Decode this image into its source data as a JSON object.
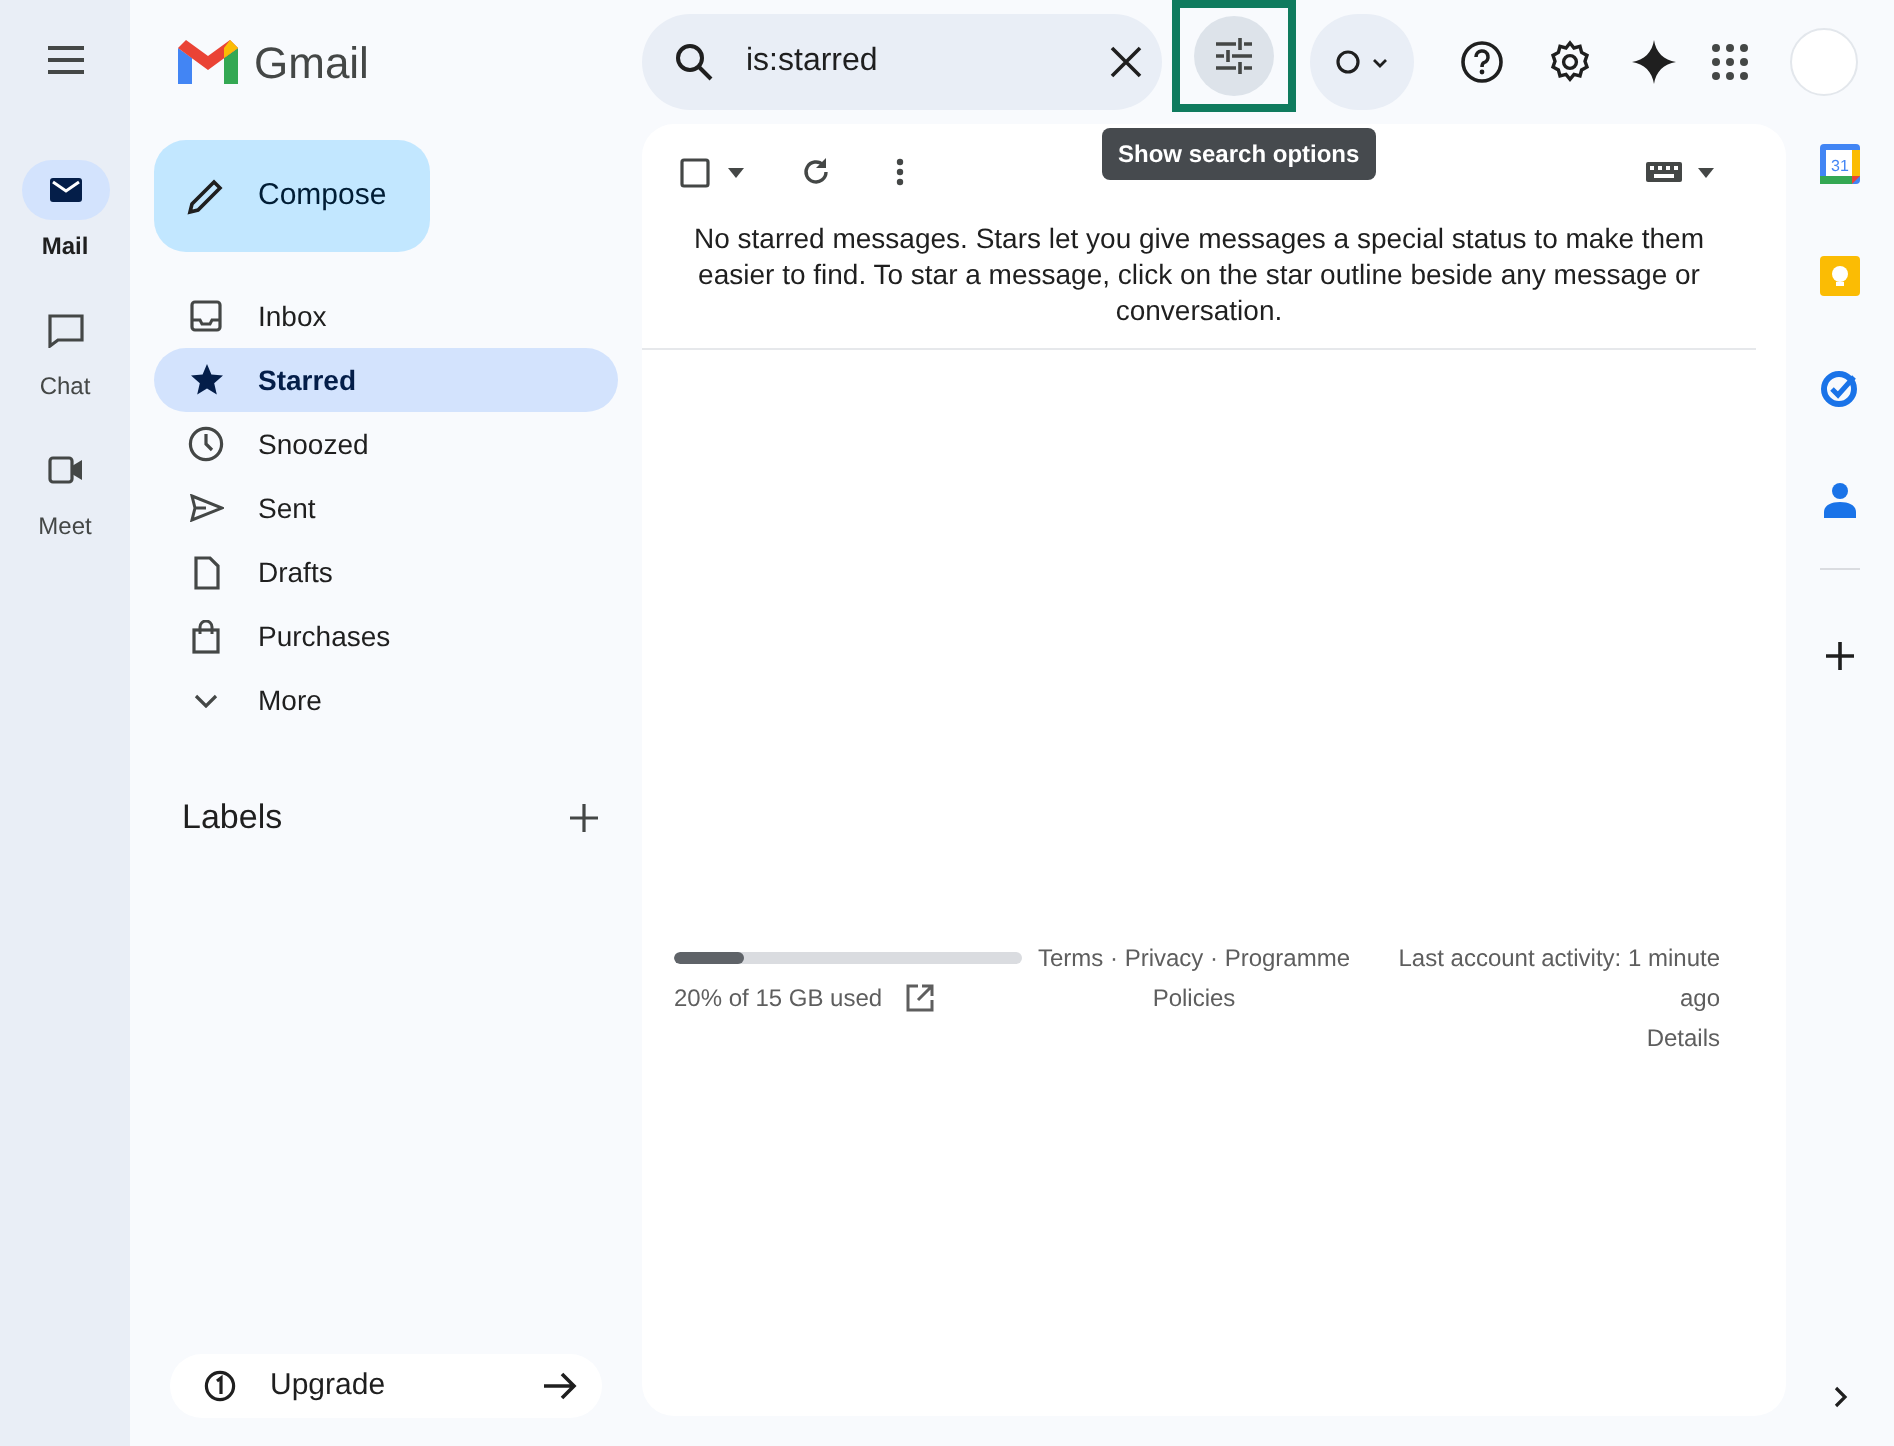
{
  "app_rail": [
    {
      "label": "Mail",
      "kind": "mail",
      "selected": true
    },
    {
      "label": "Chat",
      "kind": "chat",
      "selected": false
    },
    {
      "label": "Meet",
      "kind": "meet",
      "selected": false
    }
  ],
  "logo": {
    "text": "Gmail"
  },
  "compose": {
    "label": "Compose"
  },
  "nav": [
    {
      "label": "Inbox",
      "kind": "inbox",
      "selected": false
    },
    {
      "label": "Starred",
      "kind": "star",
      "selected": true
    },
    {
      "label": "Snoozed",
      "kind": "clock",
      "selected": false
    },
    {
      "label": "Sent",
      "kind": "send",
      "selected": false
    },
    {
      "label": "Drafts",
      "kind": "file",
      "selected": false
    },
    {
      "label": "Purchases",
      "kind": "bag",
      "selected": false
    },
    {
      "label": "More",
      "kind": "chevron",
      "selected": false
    }
  ],
  "labels": {
    "title": "Labels"
  },
  "upgrade": {
    "label": "Upgrade"
  },
  "search": {
    "value": "is:starred"
  },
  "search_options": {
    "tooltip": "Show search options",
    "highlighted": true
  },
  "select_all": {
    "checked": false
  },
  "message": "No starred messages. Stars let you give messages a special status to make them easier to find. To star a message, click on the star outline beside any message or conversation.",
  "footer": {
    "storage": {
      "level": 0.2,
      "text": "20% of 15 GB used"
    },
    "links": "Terms · Privacy · Programme Policies",
    "activity": "Last account activity: 1 minute ago",
    "details": "Details"
  },
  "side_apps": [
    {
      "kind": "calendar",
      "text": "31"
    },
    {
      "kind": "keep"
    },
    {
      "kind": "tasks"
    },
    {
      "kind": "contacts"
    }
  ]
}
